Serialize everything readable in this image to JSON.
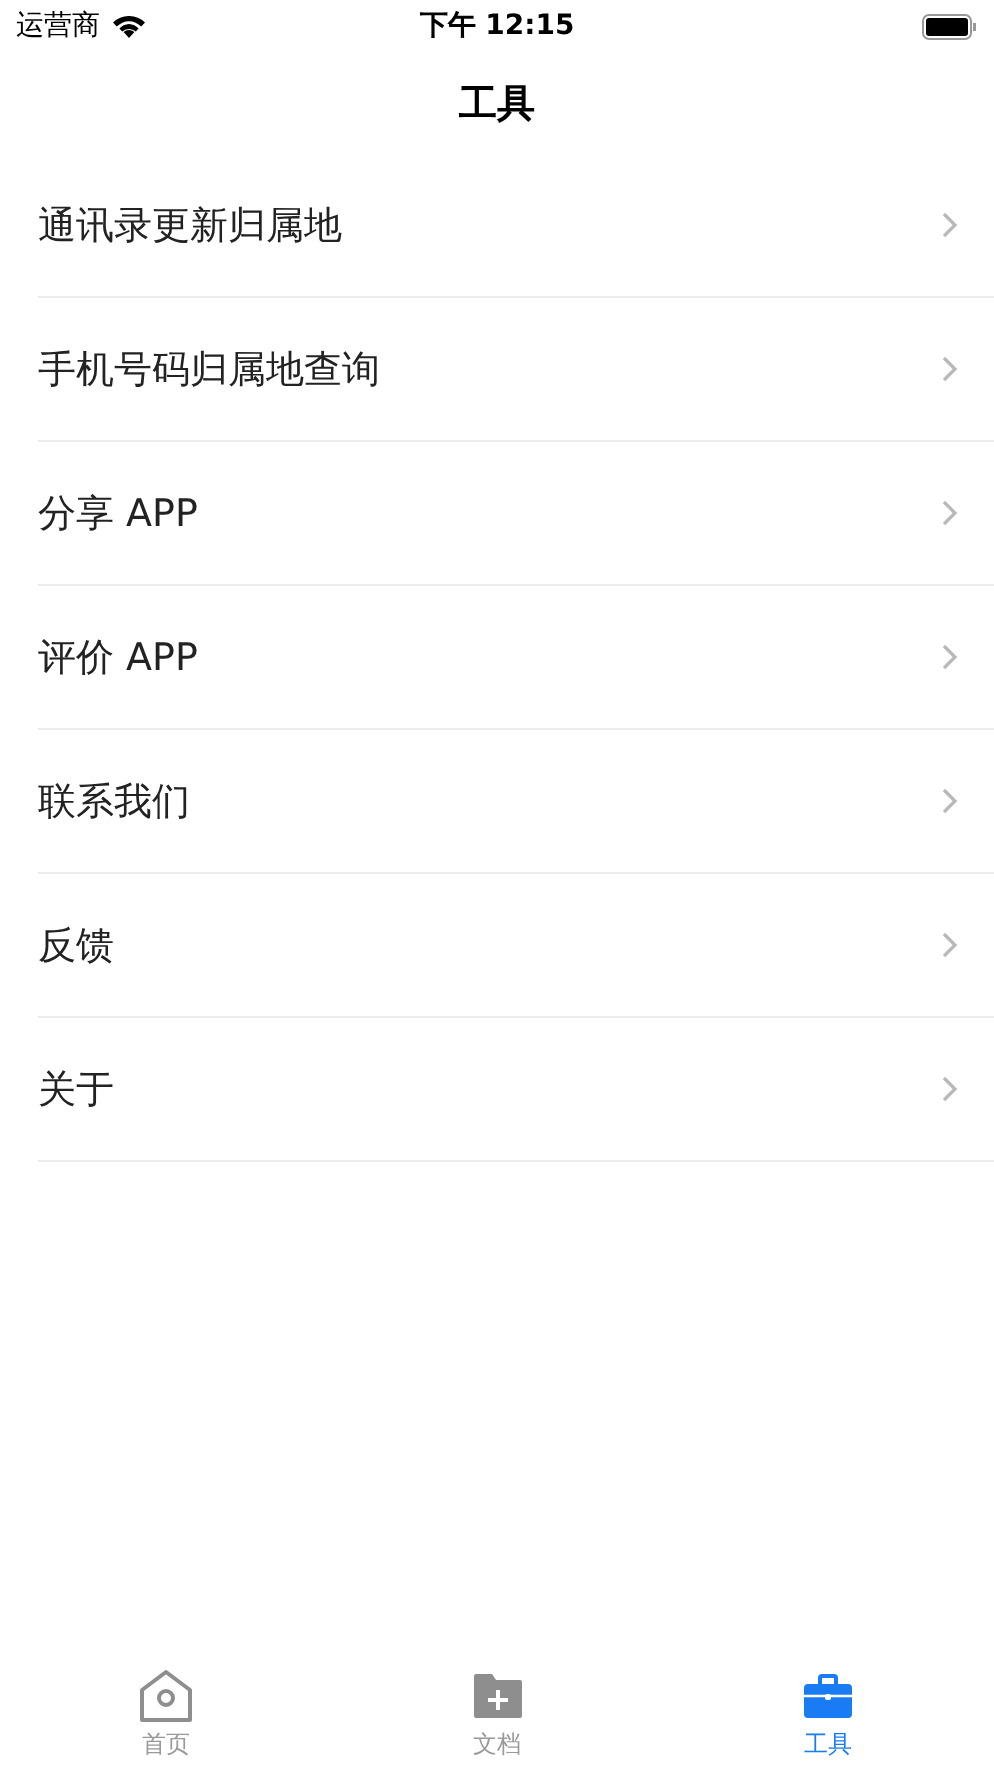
{
  "status_bar": {
    "carrier": "运营商",
    "time": "下午 12:15"
  },
  "nav": {
    "title": "工具"
  },
  "menu": [
    {
      "label": "通讯录更新归属地"
    },
    {
      "label": "手机号码归属地查询"
    },
    {
      "label": "分享 APP"
    },
    {
      "label": "评价 APP"
    },
    {
      "label": "联系我们"
    },
    {
      "label": "反馈"
    },
    {
      "label": "关于"
    }
  ],
  "tabs": [
    {
      "label": "首页",
      "selected": false
    },
    {
      "label": "文档",
      "selected": false
    },
    {
      "label": "工具",
      "selected": true
    }
  ]
}
